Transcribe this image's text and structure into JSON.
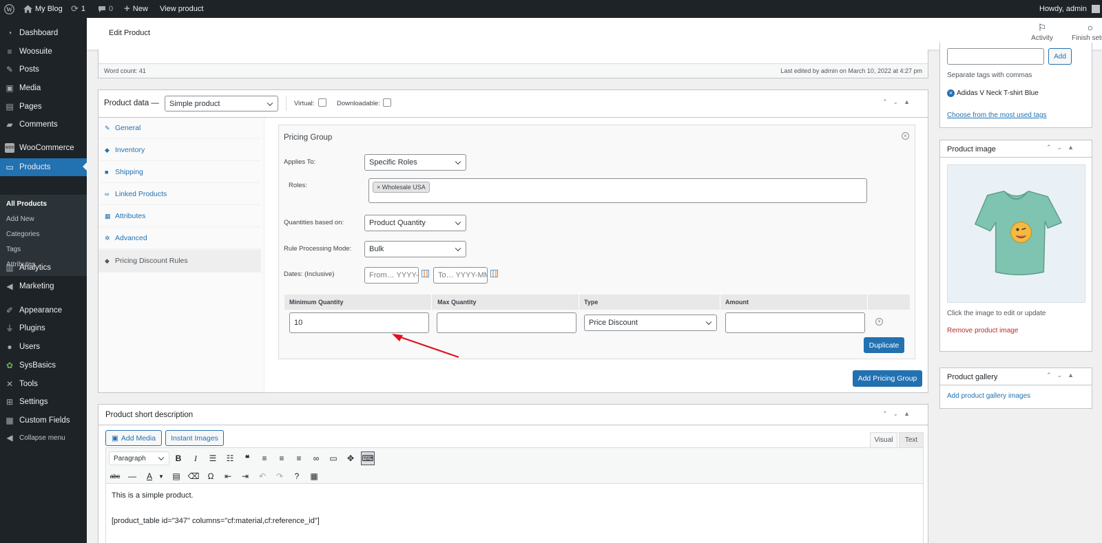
{
  "adminbar": {
    "site_name": "My Blog",
    "updates_count": "1",
    "comments_count": "0",
    "new_label": "New",
    "view_label": "View product",
    "howdy": "Howdy, admin"
  },
  "sidebar": {
    "items": [
      {
        "label": "Dashboard",
        "icon": "dashboard-icon"
      },
      {
        "label": "Woosuite",
        "icon": "woosuite-icon"
      },
      {
        "label": "Posts",
        "icon": "pin-icon"
      },
      {
        "label": "Media",
        "icon": "media-icon"
      },
      {
        "label": "Pages",
        "icon": "pages-icon"
      },
      {
        "label": "Comments",
        "icon": "comment-icon"
      },
      {
        "label": "WooCommerce",
        "icon": "woo-icon"
      },
      {
        "label": "Products",
        "icon": "archive-icon"
      },
      {
        "label": "Analytics",
        "icon": "chart-icon"
      },
      {
        "label": "Marketing",
        "icon": "megaphone-icon"
      },
      {
        "label": "Appearance",
        "icon": "brush-icon"
      },
      {
        "label": "Plugins",
        "icon": "plug-icon"
      },
      {
        "label": "Users",
        "icon": "user-icon"
      },
      {
        "label": "SysBasics",
        "icon": "sysbasics-icon"
      },
      {
        "label": "Tools",
        "icon": "wrench-icon"
      },
      {
        "label": "Settings",
        "icon": "settings-icon"
      },
      {
        "label": "Custom Fields",
        "icon": "fields-icon"
      },
      {
        "label": "Collapse menu",
        "icon": "collapse-icon"
      }
    ],
    "submenu": [
      "All Products",
      "Add New",
      "Categories",
      "Tags",
      "Attributes"
    ]
  },
  "header": {
    "title": "Edit Product",
    "activity": "Activity",
    "finish_setup": "Finish setup"
  },
  "editor_status": {
    "word_count": "Word count: 41",
    "last_edited": "Last edited by admin on March 10, 2022 at 4:27 pm"
  },
  "product_data": {
    "label": "Product data —",
    "type": "Simple product",
    "virtual": "Virtual:",
    "downloadable": "Downloadable:",
    "tabs": [
      "General",
      "Inventory",
      "Shipping",
      "Linked Products",
      "Attributes",
      "Advanced",
      "Pricing Discount Rules"
    ]
  },
  "pricing": {
    "group_title": "Pricing Group",
    "applies_to_label": "Applies To:",
    "applies_to": "Specific Roles",
    "roles_label": "Roles:",
    "role_tag": "× Wholesale USA",
    "quantities_label": "Quantities based on:",
    "quantities": "Product Quantity",
    "mode_label": "Rule Processing Mode:",
    "mode": "Bulk",
    "dates_label": "Dates: (Inclusive)",
    "from_placeholder": "From… YYYY-MM-DD",
    "to_placeholder": "To… YYYY-MM-DD",
    "columns": [
      "Minimum Quantity",
      "Max Quantity",
      "Type",
      "Amount"
    ],
    "min_qty": "10",
    "max_qty": "",
    "type": "Price Discount",
    "amount": "",
    "duplicate": "Duplicate",
    "add_group": "Add Pricing Group"
  },
  "short_desc": {
    "title": "Product short description",
    "add_media": "Add Media",
    "instant_images": "Instant Images",
    "visual_tab": "Visual",
    "text_tab": "Text",
    "format": "Paragraph",
    "line1": "This is a simple product.",
    "line2": "[product_table id=\"347\" columns=\"cf:material,cf:reference_id\"]"
  },
  "tags_box": {
    "add": "Add",
    "hint": "Separate tags with commas",
    "tag": "Adidas V Neck T-shirt Blue",
    "most_used": "Choose from the most used tags"
  },
  "image_box": {
    "title": "Product image",
    "hint": "Click the image to edit or update",
    "remove": "Remove product image"
  },
  "gallery_box": {
    "title": "Product gallery",
    "add": "Add product gallery images"
  },
  "colors": {
    "admin_dark": "#1d2327",
    "accent": "#2271b1",
    "danger": "#b32d2e",
    "arrow": "#e0121e"
  }
}
